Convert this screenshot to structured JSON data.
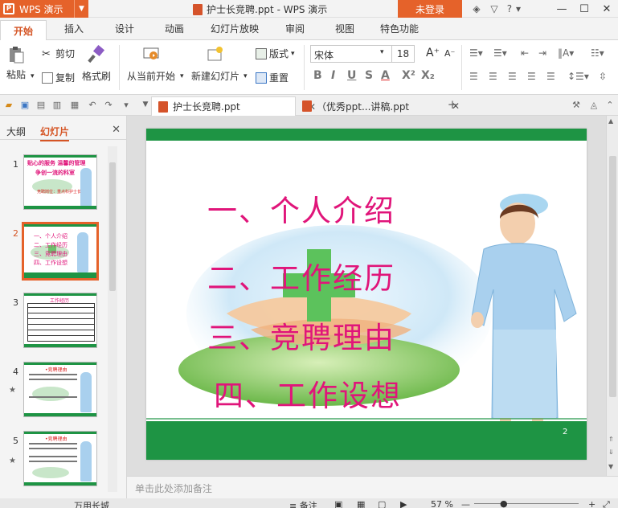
{
  "titlebar": {
    "app_name": "WPS 演示",
    "logo_letter": "P",
    "window_title": "护士长竞聘.ppt - WPS 演示",
    "login_label": "未登录",
    "help_label": "?"
  },
  "menu": {
    "tabs": [
      "开始",
      "插入",
      "设计",
      "动画",
      "幻灯片放映",
      "审阅",
      "视图",
      "特色功能"
    ],
    "active": "开始"
  },
  "ribbon": {
    "paste": "粘贴",
    "cut": "剪切",
    "copy": "复制",
    "format_painter": "格式刷",
    "from_current": "从当前开始",
    "new_slide": "新建幻灯片",
    "layout": "版式",
    "reset": "重置",
    "font_name": "宋体",
    "font_size": "18",
    "bold": "B",
    "italic": "I",
    "underline": "U",
    "strike": "S",
    "font_color": "A",
    "superscript": "X²",
    "subscript": "X₂"
  },
  "doc_tabs": [
    {
      "label": "护士长竞聘.ppt",
      "active": true
    },
    {
      "label": "（优秀ppt...讲稿.ppt",
      "active": false
    }
  ],
  "left_panel": {
    "tab_outline": "大纲",
    "tab_slides": "幻灯片",
    "slides": [
      {
        "num": "1",
        "active": false,
        "star": false
      },
      {
        "num": "2",
        "active": true,
        "star": false
      },
      {
        "num": "3",
        "active": false,
        "star": false
      },
      {
        "num": "4",
        "active": false,
        "star": true
      },
      {
        "num": "5",
        "active": false,
        "star": true
      }
    ],
    "thumb_texts": {
      "s1_line1": "贴心的服务 温馨的管理",
      "s1_line2": "争创一流的科室",
      "s1_line3": "竞聘岗位：重点科护士长",
      "s2_items": [
        "一、个人介绍",
        "二、工作经历",
        "三、竞聘理由",
        "四、工作设想"
      ],
      "s3_title": "工作经历",
      "s4_title": "•竞聘理由",
      "s5_title": "•竞聘理由"
    }
  },
  "slide": {
    "items": [
      "一、个人介绍",
      "二、工作经历",
      "三、竞聘理由",
      "四、工作设想"
    ],
    "page_number": "2"
  },
  "notes": {
    "placeholder": "单击此处添加备注"
  },
  "statusbar": {
    "theme": "万用长城",
    "notes": "备注",
    "zoom": "57 %"
  },
  "colors": {
    "accent": "#e5622a",
    "slide_green": "#1e9444",
    "slide_text": "#e0157a"
  }
}
